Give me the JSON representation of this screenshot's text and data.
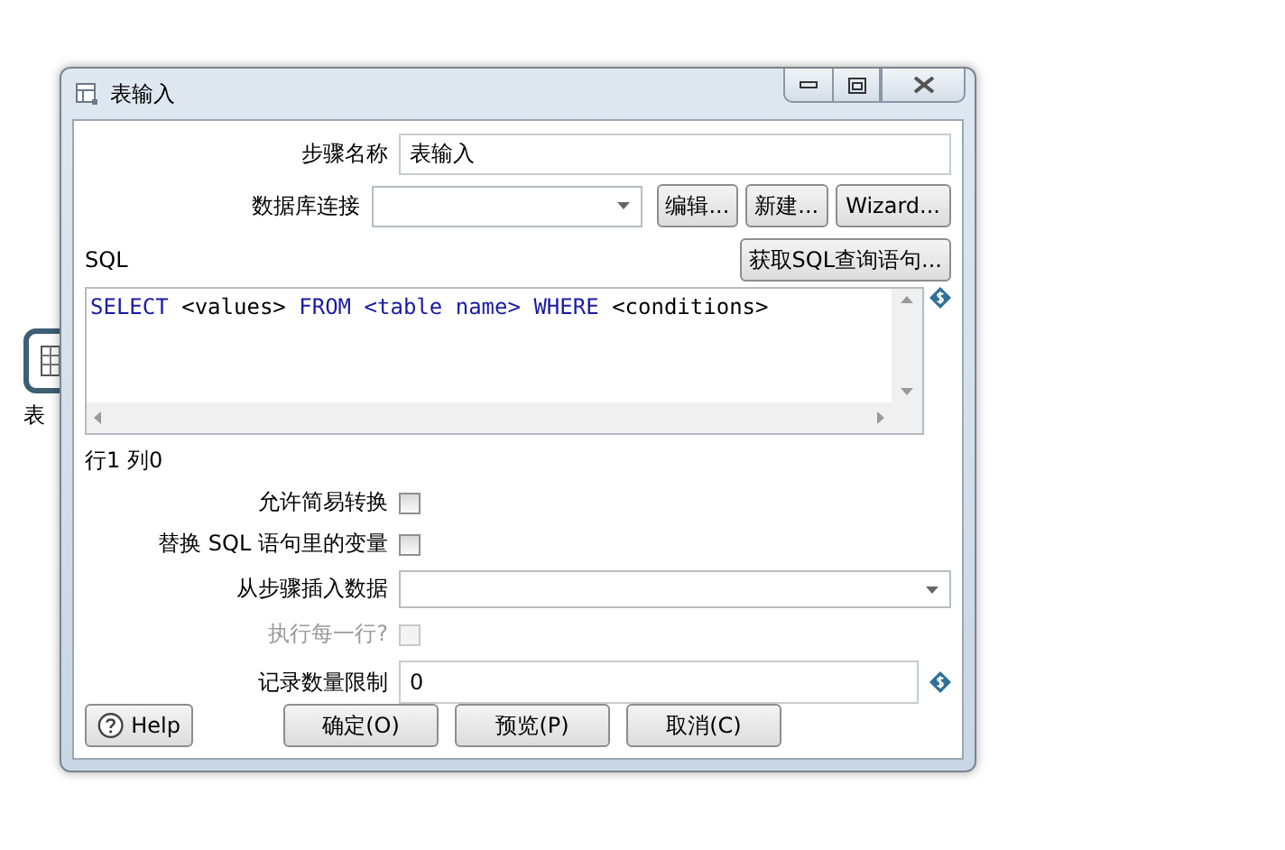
{
  "canvas_step": {
    "label": "表"
  },
  "window": {
    "title": "表输入"
  },
  "step_name": {
    "label": "步骤名称",
    "value": "表输入"
  },
  "connection": {
    "label": "数据库连接",
    "buttons": [
      "编辑...",
      "新建...",
      "Wizard..."
    ]
  },
  "sql": {
    "label": "SQL",
    "get_button": "获取SQL查询语句...",
    "tokens": [
      {
        "text": "SELECT",
        "kind": "keyword"
      },
      {
        "text": "<values>",
        "kind": "text"
      },
      {
        "text": "FROM",
        "kind": "keyword"
      },
      {
        "text": "<table name>",
        "kind": "keyword"
      },
      {
        "text": "WHERE",
        "kind": "keyword"
      },
      {
        "text": "<conditions>",
        "kind": "text"
      }
    ]
  },
  "cursor_position": "行1 列0",
  "options": [
    {
      "kind": "checkbox",
      "label": "允许简易转换",
      "checked": false,
      "disabled": false
    },
    {
      "kind": "checkbox",
      "label": "替换 SQL 语句里的变量",
      "checked": false,
      "disabled": false
    },
    {
      "kind": "combo",
      "label": "从步骤插入数据"
    },
    {
      "kind": "checkbox",
      "label": "执行每一行?",
      "checked": false,
      "disabled": true
    },
    {
      "kind": "number",
      "label": "记录数量限制",
      "value": "0"
    }
  ],
  "buttons": {
    "help": "Help",
    "actions": [
      "确定(O)",
      "预览(P)",
      "取消(C)"
    ]
  }
}
